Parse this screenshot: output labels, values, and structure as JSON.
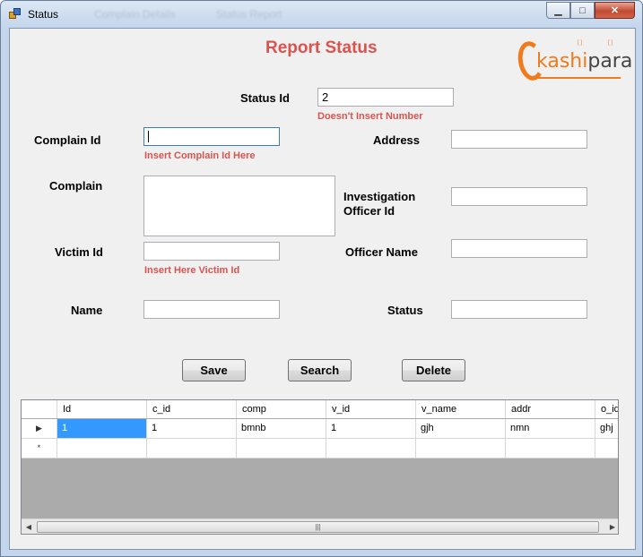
{
  "window": {
    "title": "Status",
    "ghost_titles": [
      "Complain Details",
      "Status Report"
    ],
    "minimize_icon": "minimize-icon",
    "maximize_icon": "maximize-icon",
    "close_icon": "close-icon"
  },
  "form": {
    "heading": "Report Status",
    "logo_text_a": "kashi",
    "logo_text_b": "para",
    "status_id": {
      "label": "Status Id",
      "value": "2",
      "hint": "Doesn't Insert Number"
    },
    "complain_id": {
      "label": "Complain Id",
      "value": "",
      "hint": "Insert Complain Id Here"
    },
    "address": {
      "label": "Address",
      "value": ""
    },
    "complain": {
      "label": "Complain",
      "value": ""
    },
    "investigation_officer_id": {
      "label_line1": "Investigation",
      "label_line2": "Officer Id",
      "value": ""
    },
    "victim_id": {
      "label": "Victim Id",
      "value": "",
      "hint": "Insert Here Victim Id"
    },
    "officer_name": {
      "label": "Officer Name",
      "value": ""
    },
    "name": {
      "label": "Name",
      "value": ""
    },
    "status": {
      "label": "Status",
      "value": ""
    }
  },
  "buttons": {
    "save": "Save",
    "search": "Search",
    "delete": "Delete"
  },
  "grid": {
    "columns": [
      "Id",
      "c_id",
      "comp",
      "v_id",
      "v_name",
      "addr",
      "o_id"
    ],
    "rows": [
      [
        "1",
        "1",
        "bmnb",
        "1",
        "gjh",
        "nmn",
        "ghj"
      ]
    ],
    "row_indicator": "▶",
    "new_row_indicator": "*",
    "scroll_thumb_glyph": "|||"
  }
}
